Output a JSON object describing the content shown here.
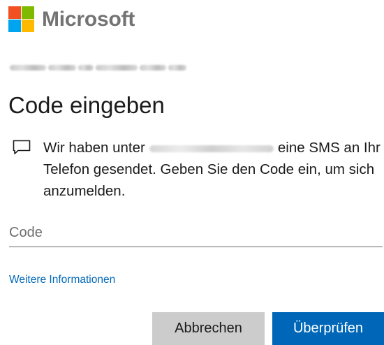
{
  "brand": {
    "name": "Microsoft",
    "logo_colors": [
      "#f25022",
      "#7fba00",
      "#00a4ef",
      "#ffb900"
    ]
  },
  "account": {
    "identifier_redacted": true
  },
  "page": {
    "title": "Code eingeben"
  },
  "message": {
    "icon": "chat-bubble-icon",
    "text_before": "Wir haben unter",
    "phone_redacted": true,
    "text_after": "eine SMS an Ihr Telefon gesendet. Geben Sie den Code ein, um sich anzumelden."
  },
  "code_field": {
    "placeholder": "Code",
    "value": ""
  },
  "links": {
    "more_info": "Weitere Informationen"
  },
  "buttons": {
    "cancel": "Abbrechen",
    "verify": "Überprüfen"
  },
  "colors": {
    "accent": "#0067b8",
    "cancel_bg": "#cccccc",
    "brand_text": "#737373"
  }
}
